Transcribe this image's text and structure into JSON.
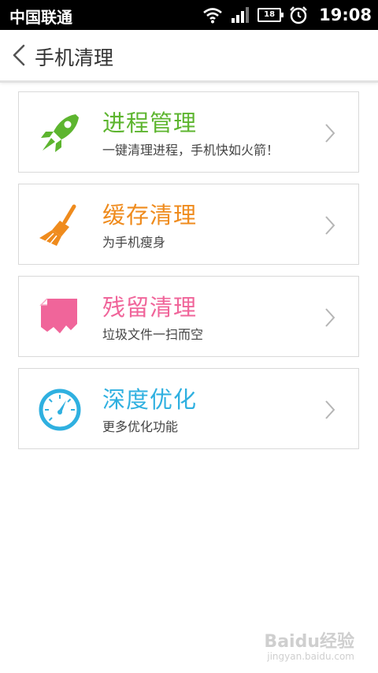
{
  "status_bar": {
    "carrier": "中国联通",
    "battery": "18",
    "time": "19:08"
  },
  "header": {
    "title": "手机清理"
  },
  "items": [
    {
      "title": "进程管理",
      "subtitle": "一键清理进程，手机快如火箭！",
      "color": "#5db52f",
      "icon": "rocket-icon"
    },
    {
      "title": "缓存清理",
      "subtitle": "为手机瘦身",
      "color": "#ef8b1d",
      "icon": "broom-icon"
    },
    {
      "title": "残留清理",
      "subtitle": "垃圾文件一扫而空",
      "color": "#f0659a",
      "icon": "torn-paper-icon"
    },
    {
      "title": "深度优化",
      "subtitle": "更多优化功能",
      "color": "#2fb0e0",
      "icon": "speedometer-icon"
    }
  ],
  "watermark": {
    "brand": "Baidu经验",
    "url": "jingyan.baidu.com"
  }
}
